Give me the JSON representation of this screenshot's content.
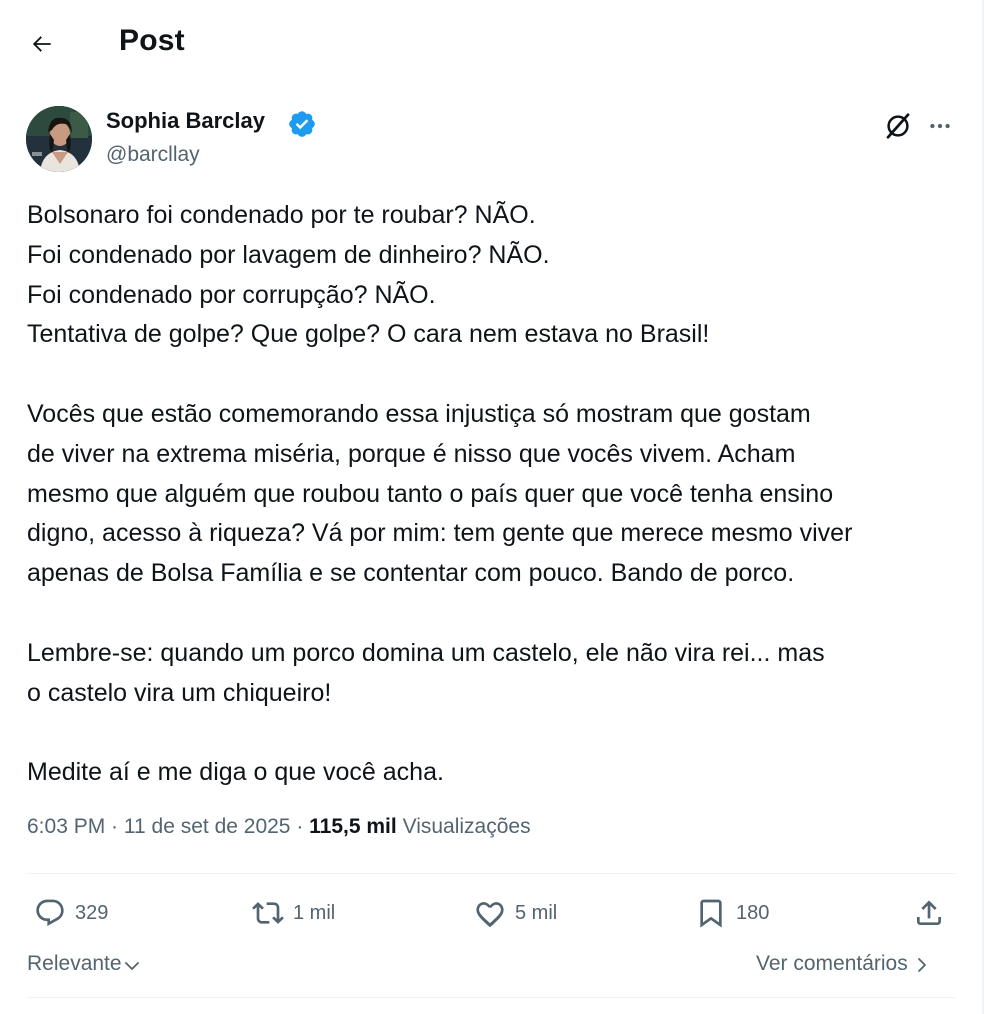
{
  "header": {
    "title": "Post"
  },
  "author": {
    "name": "Sophia Barclay",
    "handle": "@barcllay"
  },
  "post": {
    "lines": [
      "Bolsonaro foi condenado por te roubar? NÃO.",
      "Foi condenado por lavagem de dinheiro? NÃO.",
      "Foi condenado por corrupção? NÃO.",
      "Tentativa de golpe? Que golpe? O cara nem estava no Brasil!",
      "",
      "Vocês que estão comemorando essa injustiça só mostram que gostam",
      "de viver na extrema miséria, porque é nisso que vocês vivem. Acham",
      "mesmo que alguém que roubou tanto o país quer que você tenha ensino",
      "digno, acesso à riqueza? Vá por mim: tem gente que merece mesmo viver",
      "apenas de Bolsa Família e se contentar com pouco. Bando de porco.",
      "",
      "Lembre-se: quando um porco domina um castelo, ele não vira rei... mas",
      "o castelo vira um chiqueiro!",
      "",
      "Medite aí e me diga o que você acha."
    ]
  },
  "meta": {
    "time": "6:03 PM",
    "separator": " · ",
    "date": "11 de set de 2025",
    "views_count": "115,5 mil",
    "views_label": "Visualizações"
  },
  "actions": {
    "replies": "329",
    "reposts": "1 mil",
    "likes": "5 mil",
    "bookmarks": "180"
  },
  "footer": {
    "sort_label": "Relevante",
    "view_comments": "Ver comentários"
  },
  "icons": {
    "back": "arrow-left-icon",
    "verified": "verified-badge-icon",
    "grok": "grok-icon",
    "more": "more-horizontal-icon",
    "reply": "reply-icon",
    "repost": "repost-icon",
    "like": "heart-icon",
    "bookmark": "bookmark-icon",
    "share": "share-icon"
  },
  "colors": {
    "text": "#0f1419",
    "secondary": "#536471",
    "verified": "#1d9bf0",
    "divider": "#eff3f4"
  }
}
